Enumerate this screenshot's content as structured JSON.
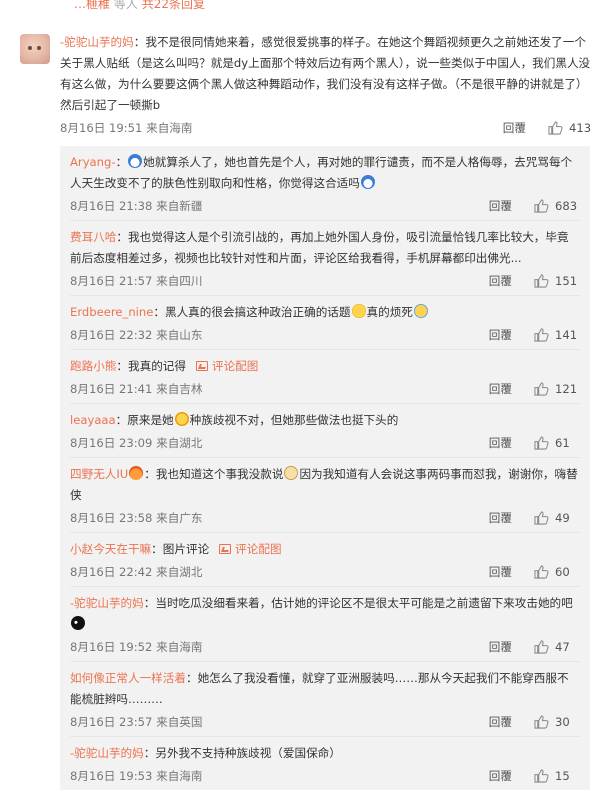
{
  "top": {
    "prefix": "…榧稚",
    "text": "等人",
    "link": "共22条回复"
  },
  "main_comment": {
    "user": "-驼驼山芋的妈",
    "text": "：我不是很同情她来着，感觉很爱挑事的样子。在她这个舞蹈视频更久之前她还发了一个关于黑人贴纸（是这么叫吗？就是dy上面那个特效后边有两个黑人），说一些类似于中国人，我们黑人没有这么做，为什么要要这俩个黑人做这种舞蹈动作，我们没有没有这样子做。（不是很平静的讲就是了）然后引起了一顿撕b",
    "time": "8月16日 19:51 来自海南",
    "reply_label": "回覆",
    "likes": "413"
  },
  "replies": [
    {
      "user": "Aryang-",
      "pre": "：",
      "emoji1": "e-dora",
      "text": "她就算杀人了，她也首先是个人，再对她的罪行谴责，而不是人格侮辱，去咒骂每个人天生改变不了的肤色性别取向和性格，你觉得这合适吗",
      "emoji2": "e-dora",
      "time": "8月16日 21:38 来自新疆",
      "reply_label": "回覆",
      "likes": "683"
    },
    {
      "user": "费耳八哈",
      "pre": "：",
      "text": "我也觉得这人是个引流引战的，再加上她外国人身份，吸引流量恰钱几率比较大，毕竟前后态度相差过多，视频也比较针对性和片面，评论区给我看得，手机屏幕都印出佛光...",
      "time": "8月16日 21:57 来自四川",
      "reply_label": "回覆",
      "likes": "151"
    },
    {
      "user": "Erdbeere_nine",
      "pre": "：",
      "text": "黑人真的很会搞这种政治正确的话题",
      "emoji1": "e-sweat",
      "text2": "真的烦死",
      "emoji2": "e-cry",
      "time": "8月16日 22:32 来自山东",
      "reply_label": "回覆",
      "likes": "141"
    },
    {
      "user": "跑路小熊",
      "pre": "：",
      "text": "我真的记得",
      "pic_label": "评论配图",
      "time": "8月16日 21:41 来自吉林",
      "reply_label": "回覆",
      "likes": "121"
    },
    {
      "user": "leayaaa",
      "pre": "：",
      "text": "原来是她",
      "emoji1": "e-shock",
      "text2": "种族歧视不对，但她那些做法也挺下头的",
      "time": "8月16日 23:09 来自湖北",
      "reply_label": "回覆",
      "likes": "61"
    },
    {
      "user": "四野无人IU",
      "pre": "：",
      "badge": "e-fire",
      "text": "我也知道这个事我没款说",
      "emoji1": "e-doge",
      "text2": "因为我知道有人会说这事两码事而怼我，谢谢你，嗨替侠",
      "time": "8月16日 23:58 来自广东",
      "reply_label": "回覆",
      "likes": "49"
    },
    {
      "user": "小赵今天在干嘛",
      "pre": "：",
      "text": "图片评论",
      "pic_label": "评论配图",
      "time": "8月16日 22:42 来自湖北",
      "reply_label": "回覆",
      "likes": "60"
    },
    {
      "user": "-驼驼山芋的妈",
      "pre": "：",
      "text": "当时吃瓜没细看来着，估计她的评论区不是很太平可能是之前遗留下来攻击她的吧",
      "emoji1": "e-black",
      "time": "8月16日 19:52 来自海南",
      "reply_label": "回覆",
      "likes": "47"
    },
    {
      "user": "如何像正常人一样活着",
      "pre": "：",
      "text": "她怎么了我没看懂，就穿了亚洲服装吗……那从今天起我们不能穿西服不能梳脏辫吗………",
      "time": "8月16日 23:57 来自英国",
      "reply_label": "回覆",
      "likes": "30"
    },
    {
      "user": "-驼驼山芋的妈",
      "pre": "：",
      "text": "另外我不支持种族歧视（爱国保命）",
      "time": "8月16日 19:53 来自海南",
      "reply_label": "回覆",
      "likes": "15"
    }
  ]
}
